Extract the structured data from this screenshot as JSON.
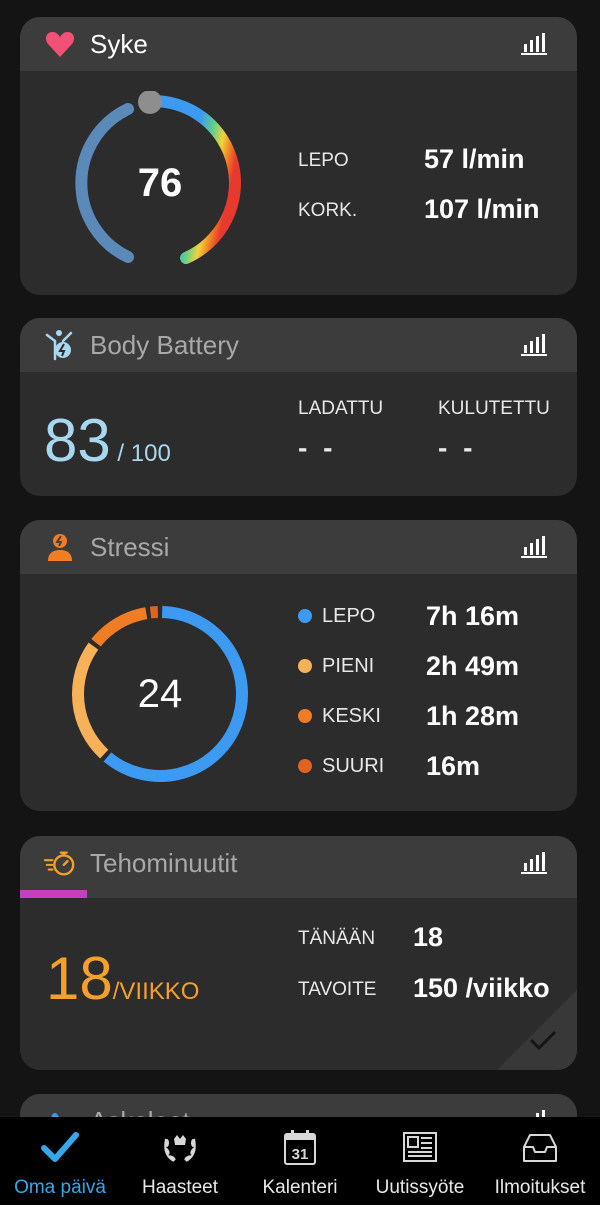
{
  "colors": {
    "card_bg": "#2c2c2c",
    "header_bg": "#3c3c3c",
    "heart": "#f25077",
    "body_battery_value": "#a8d8f0",
    "stress_rest": "#3d9af2",
    "stress_low": "#f7b259",
    "stress_medium": "#f07d23",
    "stress_high": "#e0641e",
    "intensity_orange": "#f5a028",
    "intensity_progress": "#c63fc0",
    "active_nav": "#35a8ea"
  },
  "heart_rate": {
    "title": "Syke",
    "icon": "heart-icon",
    "current": "76",
    "rest_label": "LEPO",
    "rest_value": "57 l/min",
    "max_label": "KORK.",
    "max_value": "107 l/min"
  },
  "body_battery": {
    "title": "Body Battery",
    "icon": "body-battery-icon",
    "value": "83",
    "max": " / 100",
    "charged_label": "LADATTU",
    "charged_value": "- -",
    "drained_label": "KULUTETTU",
    "drained_value": "- -"
  },
  "stress": {
    "title": "Stressi",
    "icon": "stress-person-icon",
    "value": "24",
    "items": [
      {
        "label": "LEPO",
        "value": "7h 16m",
        "color": "#3d9af2"
      },
      {
        "label": "PIENI",
        "value": "2h 49m",
        "color": "#f7b259"
      },
      {
        "label": "KESKI",
        "value": "1h 28m",
        "color": "#f07d23"
      },
      {
        "label": "SUURI",
        "value": "16m",
        "color": "#e0641e"
      }
    ]
  },
  "intensity": {
    "title": "Tehominuutit",
    "icon": "stopwatch-icon",
    "value": "18",
    "unit": "/VIIKKO",
    "progress_fraction": 0.12,
    "today_label": "TÄNÄÄN",
    "today_value": "18",
    "goal_label": "TAVOITE",
    "goal_value": "150 /viikko"
  },
  "steps": {
    "title": "Askeleet"
  },
  "nav": [
    {
      "label": "Oma päivä",
      "icon": "checkmark-icon",
      "active": true
    },
    {
      "label": "Haasteet",
      "icon": "laurel-icon",
      "active": false
    },
    {
      "label": "Kalenteri",
      "icon": "calendar-icon",
      "active": false
    },
    {
      "label": "Uutissyöte",
      "icon": "newsfeed-icon",
      "active": false
    },
    {
      "label": "Ilmoitukset",
      "icon": "inbox-icon",
      "active": false
    }
  ],
  "calendar_day": "31"
}
